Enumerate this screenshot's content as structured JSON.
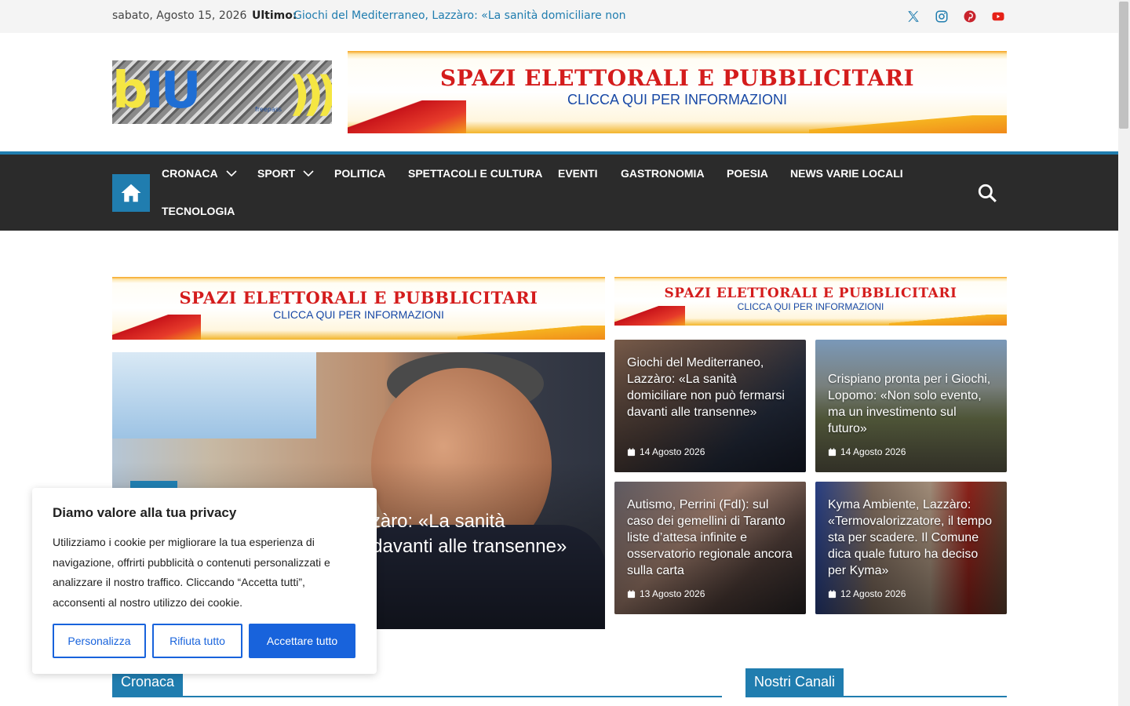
{
  "topbar": {
    "date": "sabato, Agosto 15, 2026",
    "latest_label": "Ultimo:",
    "latest_text": "Giochi del Mediterraneo, Lazzàro: «La sanità domiciliare non",
    "social": [
      "x-icon",
      "instagram-icon",
      "pinterest-icon",
      "youtube-icon"
    ]
  },
  "logo": {
    "letters_b": "b",
    "letters_iu": "IU",
    "arcs": ")))",
    "tagline": "freepass"
  },
  "banner": {
    "title": "SPAZI ELETTORALI E PUBBLICITARI",
    "subtitle": "CLICCA QUI PER INFORMAZIONI"
  },
  "nav": {
    "items": [
      {
        "label": "CRONACA",
        "has_dropdown": true
      },
      {
        "label": "SPORT",
        "has_dropdown": true
      },
      {
        "label": "POLITICA"
      },
      {
        "label": "SPETTACOLI E CULTURA"
      },
      {
        "label": "EVENTI"
      },
      {
        "label": "GASTRONOMIA"
      },
      {
        "label": "POESIA"
      },
      {
        "label": "NEWS VARIE LOCALI"
      },
      {
        "label": "TECNOLOGIA"
      }
    ]
  },
  "feature": {
    "title": "Giochi del Mediterraneo, Lazzàro: «La sanità domiciliare non può fermarsi davanti alle transenne»"
  },
  "tiles": [
    {
      "title": "Giochi del Mediterraneo, Lazzàro: «La sanità domiciliare non può fermarsi davanti alle transenne»",
      "date": "14 Agosto 2026"
    },
    {
      "title": "Crispiano pronta per i Giochi, Lopomo: «Non solo evento, ma un investimento sul futuro»",
      "date": "14 Agosto 2026"
    },
    {
      "title": "Autismo, Perrini (FdI): sul caso dei gemellini di Taranto liste d’attesa infinite e osservatorio regionale ancora sulla carta",
      "date": "13 Agosto 2026"
    },
    {
      "title": "Kyma Ambiente, Lazzàro: «Termovalorizzatore, il tempo sta per scadere. Il Comune dica quale futuro ha deciso per Kyma»",
      "date": "12 Agosto 2026"
    }
  ],
  "sections": {
    "cronaca": "Cronaca",
    "canali": "Nostri Canali"
  },
  "cookie": {
    "title": "Diamo valore alla tua privacy",
    "text": "Utilizziamo i cookie per migliorare la tua esperienza di navigazione, offrirti pubblicità o contenuti personalizzati e analizzare il nostro traffico. Cliccando “Accetta tutti”, acconsenti al nostro utilizzo dei cookie.",
    "customize": "Personalizza",
    "reject": "Rifiuta tutto",
    "accept": "Accettare tutto"
  },
  "colors": {
    "accent": "#207daf",
    "nav_bg": "#2b2b2b",
    "cookie_blue": "#1863dc"
  }
}
